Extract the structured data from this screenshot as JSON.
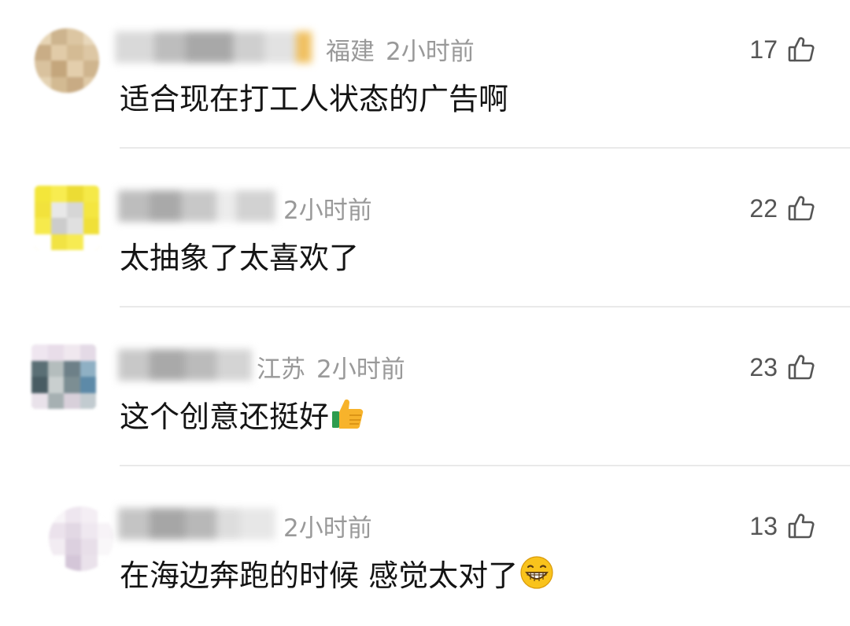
{
  "comments": [
    {
      "location": "福建",
      "time": "2小时前",
      "text": "适合现在打工人状态的广告啊",
      "emoji": "",
      "likes": "17"
    },
    {
      "location": "",
      "time": "2小时前",
      "text": "太抽象了太喜欢了",
      "emoji": "",
      "likes": "22"
    },
    {
      "location": "江苏",
      "time": "2小时前",
      "text": "这个创意还挺好",
      "emoji": "thumbs-up-emoji",
      "likes": "23"
    },
    {
      "location": "",
      "time": "2小时前",
      "text": "在海边奔跑的时候 感觉太对了",
      "emoji": "grinning-emoji",
      "likes": "13"
    }
  ],
  "colors": {
    "meta_text": "#999999",
    "content_text": "#141414",
    "like_count": "#555555",
    "divider": "#e9e9e9",
    "thumb_emoji": "#f7b32b"
  }
}
